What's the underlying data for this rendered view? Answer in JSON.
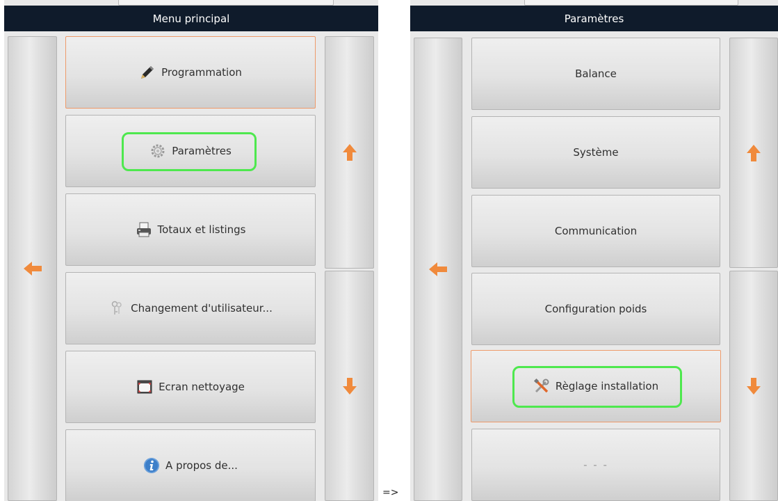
{
  "left_panel": {
    "title": "Menu principal",
    "items": [
      {
        "label": "Programmation",
        "icon": "pencil-icon",
        "selected": true
      },
      {
        "label": "Paramètres",
        "icon": "gear-icon",
        "highlighted": true
      },
      {
        "label": "Totaux et listings",
        "icon": "printer-icon"
      },
      {
        "label": "Changement d'utilisateur...",
        "icon": "keys-icon"
      },
      {
        "label": "Ecran nettoyage",
        "icon": "screen-icon"
      },
      {
        "label": "A propos de...",
        "icon": "info-icon"
      }
    ],
    "nav": {
      "back": "arrow-left-icon",
      "up": "arrow-up-icon",
      "down": "arrow-down-icon"
    }
  },
  "separator": "=>",
  "right_panel": {
    "title": "Paramètres",
    "items": [
      {
        "label": "Balance"
      },
      {
        "label": "Système"
      },
      {
        "label": "Communication"
      },
      {
        "label": "Configuration poids"
      },
      {
        "label": "Règlage installation",
        "icon": "tools-icon",
        "selected": true,
        "highlighted": true
      },
      {
        "label": "- - -"
      }
    ],
    "nav": {
      "back": "arrow-left-icon",
      "up": "arrow-up-icon",
      "down": "arrow-down-icon"
    }
  },
  "colors": {
    "titlebar": "#0f1b2b",
    "arrow": "#f08a3c",
    "selected_border": "#ee9a6a",
    "highlight": "#4ee84e"
  }
}
